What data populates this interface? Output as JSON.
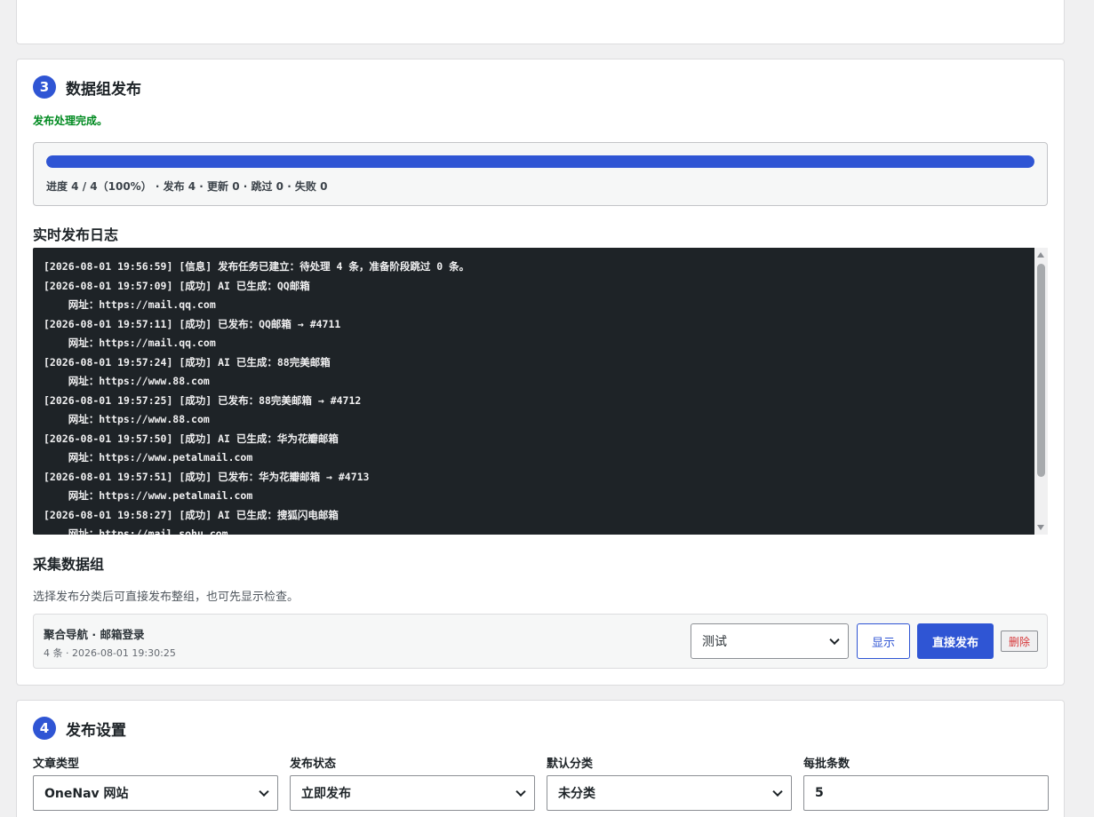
{
  "section3": {
    "number": "3",
    "title": "数据组发布",
    "status_message": "发布处理完成。",
    "progress": {
      "fraction": 1.0,
      "text": "进度 4 / 4（100%） · 发布 4 · 更新 0 · 跳过 0 · 失败 0"
    },
    "log_title": "实时发布日志",
    "log_lines": [
      "[2026-08-01 19:56:59] [信息] 发布任务已建立：待处理 4 条，准备阶段跳过 0 条。",
      "[2026-08-01 19:57:09] [成功] AI 已生成：QQ邮箱",
      "    网址：https://mail.qq.com",
      "[2026-08-01 19:57:11] [成功] 已发布：QQ邮箱 → #4711",
      "    网址：https://mail.qq.com",
      "[2026-08-01 19:57:24] [成功] AI 已生成：88完美邮箱",
      "    网址：https://www.88.com",
      "[2026-08-01 19:57:25] [成功] 已发布：88完美邮箱 → #4712",
      "    网址：https://www.88.com",
      "[2026-08-01 19:57:50] [成功] AI 已生成：华为花瓣邮箱",
      "    网址：https://www.petalmail.com",
      "[2026-08-01 19:57:51] [成功] 已发布：华为花瓣邮箱 → #4713",
      "    网址：https://www.petalmail.com",
      "[2026-08-01 19:58:27] [成功] AI 已生成：搜狐闪电邮箱",
      "    网址：https://mail.sohu.com"
    ],
    "groups_title": "采集数据组",
    "groups_desc": "选择发布分类后可直接发布整组，也可先显示检查。",
    "group": {
      "name": "聚合导航 · 邮箱登录",
      "meta": "4 条 · 2026-08-01 19:30:25",
      "category_selected": "测试",
      "show_label": "显示",
      "publish_label": "直接发布",
      "delete_label": "删除"
    }
  },
  "section4": {
    "number": "4",
    "title": "发布设置",
    "fields": {
      "post_type": {
        "label": "文章类型",
        "value": "OneNav 网站"
      },
      "post_status": {
        "label": "发布状态",
        "value": "立即发布"
      },
      "default_category": {
        "label": "默认分类",
        "value": "未分类"
      },
      "batch_size": {
        "label": "每批条数",
        "value": "5"
      }
    }
  },
  "colors": {
    "accent": "#2f55d4",
    "success": "#008a20",
    "log_bg": "#1e2327",
    "danger": "#d63638"
  }
}
